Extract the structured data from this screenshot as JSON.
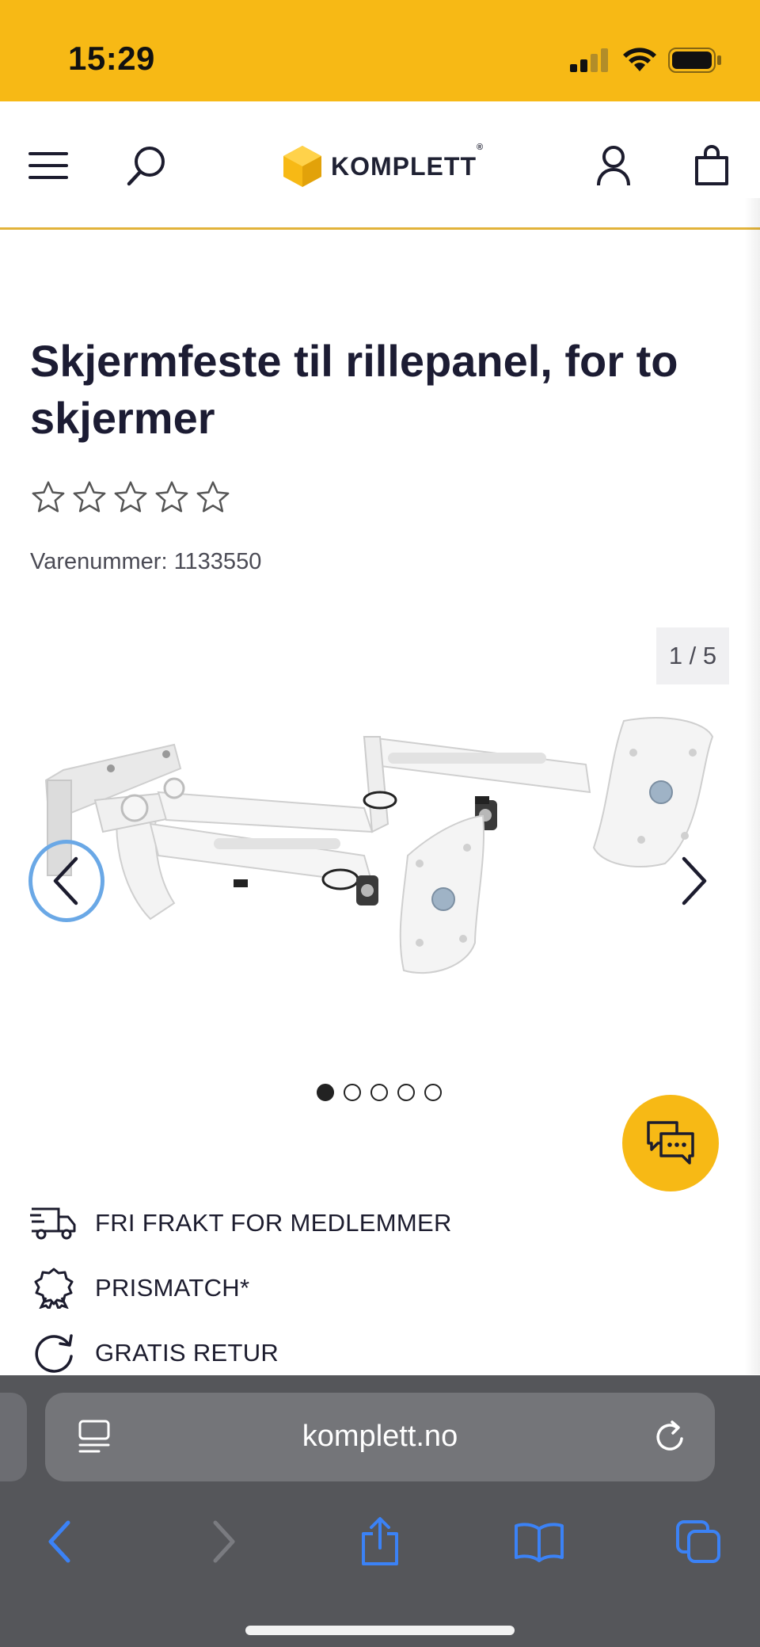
{
  "status_bar": {
    "time": "15:29"
  },
  "header": {
    "logo_text": "KOMPLETT",
    "logo_mark": "®"
  },
  "product": {
    "title": "Skjermfeste til rillepanel, for to skjermer",
    "rating_stars_filled": 0,
    "rating_stars_total": 5,
    "sku": "Varenummer: 1133550"
  },
  "gallery": {
    "counter": "1 / 5",
    "current_index": 1,
    "total_images": 5
  },
  "usps": [
    {
      "icon": "delivery-truck-icon",
      "label": "FRI FRAKT FOR MEDLEMMER"
    },
    {
      "icon": "award-ribbon-icon",
      "label": "PRISMATCH*"
    },
    {
      "icon": "return-arrow-icon",
      "label": "GRATIS RETUR"
    }
  ],
  "browser": {
    "url": "komplett.no"
  },
  "colors": {
    "brand_yellow": "#f7b915",
    "safari_link_blue": "#3b82f6"
  }
}
